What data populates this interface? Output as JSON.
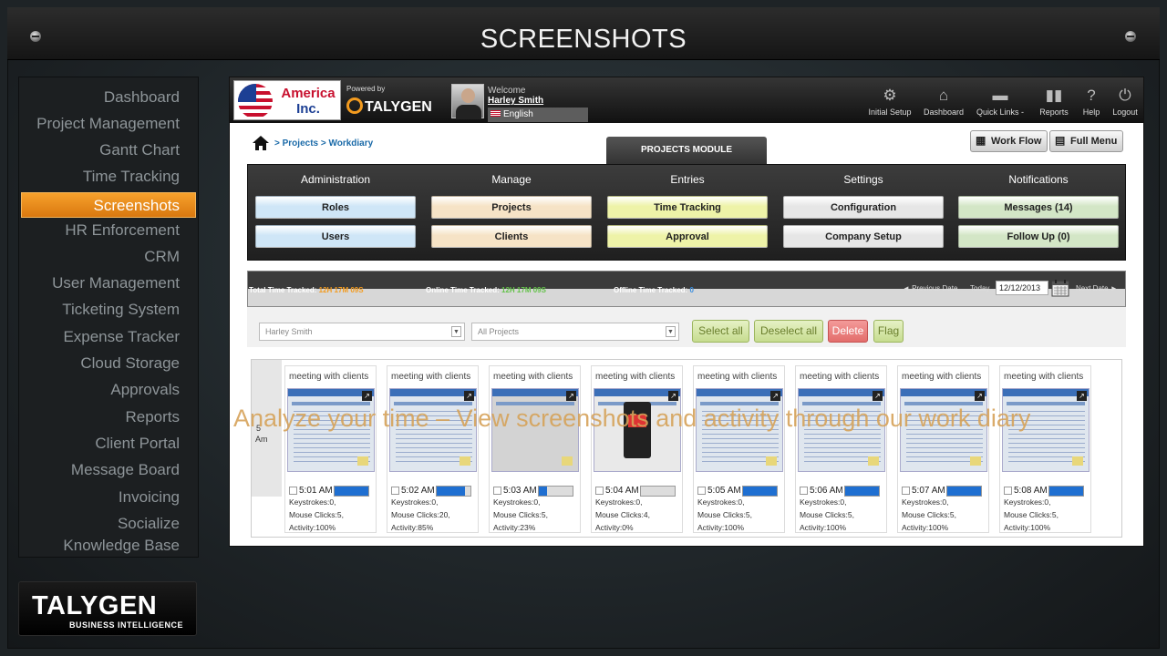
{
  "window": {
    "title": "SCREENSHOTS"
  },
  "sidebar": {
    "items": [
      {
        "label": "Dashboard",
        "active": false
      },
      {
        "label": "Project Management",
        "active": false
      },
      {
        "label": "Gantt Chart",
        "active": false
      },
      {
        "label": "Time Tracking",
        "active": false
      },
      {
        "label": "Screenshots",
        "active": true
      },
      {
        "label": "HR Enforcement",
        "active": false
      },
      {
        "label": "CRM",
        "active": false
      },
      {
        "label": "User Management",
        "active": false
      },
      {
        "label": "Ticketing System",
        "active": false
      },
      {
        "label": "Expense Tracker",
        "active": false
      },
      {
        "label": "Cloud Storage",
        "active": false
      },
      {
        "label": "Approvals",
        "active": false
      },
      {
        "label": "Reports",
        "active": false
      },
      {
        "label": "Client Portal",
        "active": false
      },
      {
        "label": "Message Board",
        "active": false
      },
      {
        "label": "Invoicing",
        "active": false
      },
      {
        "label": "Socialize",
        "active": false
      },
      {
        "label": "Knowledge Base",
        "active": false
      }
    ],
    "accent_color": "#f08c1a"
  },
  "footer_logo": {
    "name": "TALYGEN",
    "tagline": "BUSINESS INTELLIGENCE"
  },
  "app": {
    "company": {
      "line1": "America",
      "line2": "Inc."
    },
    "powered_by": "Powered by",
    "powered_logo": "TALYGEN",
    "welcome": "Welcome",
    "user_name": "Harley Smith",
    "language": "English",
    "top_links": [
      {
        "label": "Initial Setup",
        "icon": "gear-icon"
      },
      {
        "label": "Dashboard",
        "icon": "home-icon"
      },
      {
        "label": "Quick Links -",
        "icon": "quicklinks-icon"
      },
      {
        "label": "Reports",
        "icon": "bar-chart-icon"
      },
      {
        "label": "Help",
        "icon": "help-icon"
      },
      {
        "label": "Logout",
        "icon": "power-icon"
      }
    ],
    "breadcrumb": "> Projects > Workdiary",
    "module_tab": "PROJECTS MODULE",
    "header_buttons": {
      "workflow": "Work Flow",
      "full_menu": "Full Menu"
    },
    "module_columns": [
      {
        "head": "Administration",
        "buttons": [
          "Roles",
          "Users"
        ],
        "color": "#cfe6f7"
      },
      {
        "head": "Manage",
        "buttons": [
          "Projects",
          "Clients"
        ],
        "color": "#f6e3c6"
      },
      {
        "head": "Entries",
        "buttons": [
          "Time Tracking",
          "Approval"
        ],
        "color": "#eef3a8"
      },
      {
        "head": "Settings",
        "buttons": [
          "Configuration",
          "Company Setup"
        ],
        "color": "#e6e6e6"
      },
      {
        "head": "Notifications",
        "buttons": [
          "Messages (14)",
          "Follow Up (0)"
        ],
        "color": "#d3e6c6"
      }
    ],
    "time_tracked": {
      "total_label": "Total Time Tracked:",
      "total_value": "12H 17M 09S",
      "online_label": "Online Time Tracked:",
      "online_value": "12H 17M 09S",
      "offline_label": "Offline Time Tracked:",
      "offline_value": "0"
    },
    "date_nav": {
      "prev": "◄ Previous Date",
      "today": "Today",
      "date": "12/12/2013",
      "next": "Next Date ►"
    },
    "filters": {
      "user": "Harley Smith",
      "project": "All Projects"
    },
    "actions": {
      "select_all": "Select all",
      "deselect_all": "Deselect all",
      "delete": "Delete",
      "flag": "Flag"
    },
    "hour_label": "5",
    "hour_suffix": "Am",
    "screenshots": [
      {
        "title": "meeting with clients",
        "time": "5:01 AM",
        "activity": 1.0,
        "keystrokes": "Keystrokes:0,",
        "clicks": "Mouse Clicks:5,",
        "activity_label": "Activity:100%",
        "thumb": "normal"
      },
      {
        "title": "meeting with clients",
        "time": "5:02 AM",
        "activity": 0.85,
        "keystrokes": "Keystrokes:0,",
        "clicks": "Mouse Clicks:20,",
        "activity_label": "Activity:85%",
        "thumb": "normal"
      },
      {
        "title": "meeting with clients",
        "time": "5:03 AM",
        "activity": 0.23,
        "keystrokes": "Keystrokes:0,",
        "clicks": "Mouse Clicks:5,",
        "activity_label": "Activity:23%",
        "thumb": "gray"
      },
      {
        "title": "meeting with clients",
        "time": "5:04 AM",
        "activity": 0.0,
        "keystrokes": "Keystrokes:0,",
        "clicks": "Mouse Clicks:4,",
        "activity_label": "Activity:0%",
        "thumb": "phone"
      },
      {
        "title": "meeting with clients",
        "time": "5:05 AM",
        "activity": 1.0,
        "keystrokes": "Keystrokes:0,",
        "clicks": "Mouse Clicks:5,",
        "activity_label": "Activity:100%",
        "thumb": "normal"
      },
      {
        "title": "meeting with clients",
        "time": "5:06 AM",
        "activity": 1.0,
        "keystrokes": "Keystrokes:0,",
        "clicks": "Mouse Clicks:5,",
        "activity_label": "Activity:100%",
        "thumb": "normal"
      },
      {
        "title": "meeting with clients",
        "time": "5:07 AM",
        "activity": 1.0,
        "keystrokes": "Keystrokes:0,",
        "clicks": "Mouse Clicks:5,",
        "activity_label": "Activity:100%",
        "thumb": "normal"
      },
      {
        "title": "meeting with clients",
        "time": "5:08 AM",
        "activity": 1.0,
        "keystrokes": "Keystrokes:0,",
        "clicks": "Mouse Clicks:5,",
        "activity_label": "Activity:100%",
        "thumb": "normal"
      }
    ]
  },
  "caption": "Analyze your time – View screenshots and activity through our work diary"
}
